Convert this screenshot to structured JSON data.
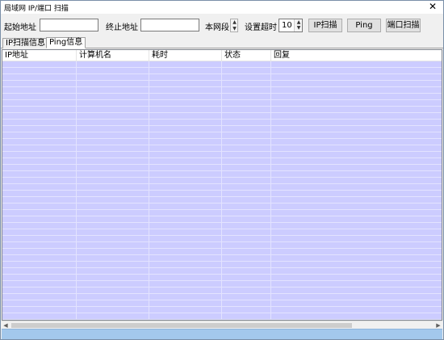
{
  "window": {
    "title": "局域网 IP/端口 扫描",
    "close_glyph": "✕"
  },
  "toolbar": {
    "start_label": "起始地址",
    "start_value": "",
    "end_label": "终止地址",
    "end_value": "",
    "segment_label": "本网段",
    "timeout_label": "设置超时",
    "timeout_value": "10",
    "ip_scan_button": "IP扫描",
    "ping_button": "Ping",
    "port_scan_button": "端口扫描"
  },
  "tabs": [
    {
      "label": "IP扫描信息",
      "active": false
    },
    {
      "label": "Ping信息",
      "active": true
    }
  ],
  "table": {
    "columns": [
      "IP地址",
      "计算机名",
      "耗时",
      "状态",
      "回复"
    ],
    "rows": []
  },
  "colors": {
    "grid_background": "#ccccff",
    "statusbar": "#a3c8ec"
  },
  "icons": {
    "close": "close-icon",
    "spinner_up": "triangle-up-icon",
    "spinner_down": "triangle-down-icon",
    "scroll_left": "triangle-left-icon",
    "scroll_right": "triangle-right-icon"
  }
}
